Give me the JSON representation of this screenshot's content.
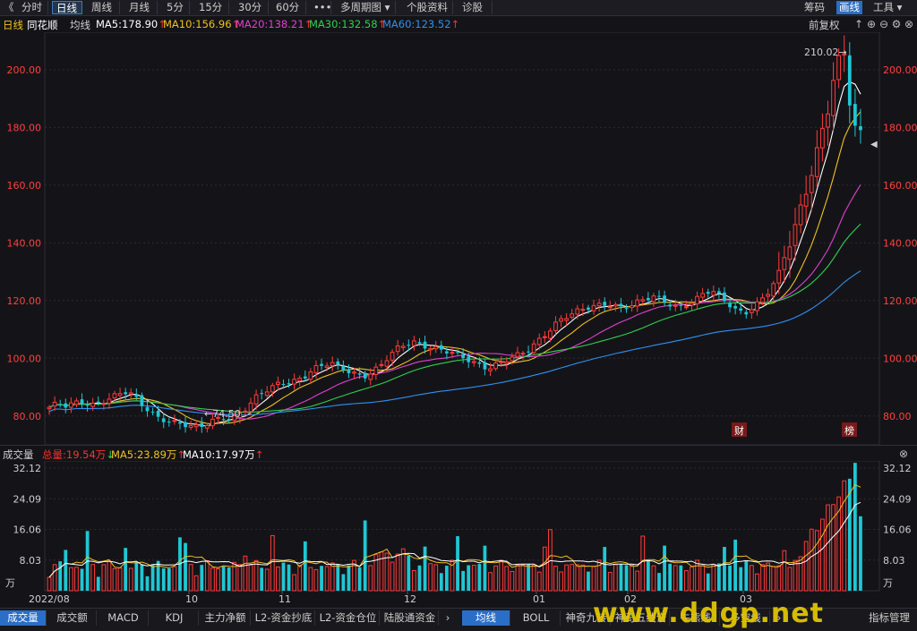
{
  "toolbar": {
    "back_icon": "《",
    "tabs": [
      "分时",
      "日线",
      "周线",
      "月线",
      "5分",
      "15分",
      "30分",
      "60分",
      "•••",
      "多周期图",
      "个股资料",
      "诊股"
    ],
    "active_tab": 1,
    "right_items": [
      "筹码",
      "画线",
      "工具"
    ]
  },
  "infobar": {
    "period": "日线",
    "stock_name": "同花顺",
    "ma_label": "均线",
    "ma_values": [
      {
        "text": "MA5:178.90",
        "color": "#ffffff"
      },
      {
        "text": "MA10:156.96",
        "color": "#f0c020"
      },
      {
        "text": "MA20:138.21",
        "color": "#e040d0"
      },
      {
        "text": "MA30:132.58",
        "color": "#30d050"
      },
      {
        "text": "MA60:123.52",
        "color": "#3090f0"
      }
    ],
    "adjust": "前复权"
  },
  "volbar": {
    "title": "成交量",
    "total": "总量:19.54万",
    "ma5": "MA5:23.89万",
    "ma10": "MA10:17.97万"
  },
  "chart_data": [
    {
      "type": "candlestick",
      "title": "同花顺 日线",
      "y_ticks": [
        "200.00",
        "180.00",
        "160.00",
        "140.00",
        "120.00",
        "100.00",
        "80.00"
      ],
      "ylim": [
        70,
        213
      ],
      "annotations": {
        "high": "210.02→",
        "low": "←74.50",
        "markers": [
          "财",
          "榜"
        ]
      },
      "price_path": [
        83,
        84,
        83,
        84,
        85,
        84,
        85,
        86,
        87,
        88,
        87,
        84,
        82,
        80,
        79,
        78,
        77,
        76,
        75.5,
        77,
        79,
        80,
        79,
        81,
        83,
        86,
        88,
        90,
        92,
        92,
        93,
        94,
        96,
        97,
        98,
        97,
        96,
        95,
        94,
        95,
        97,
        100,
        103,
        105,
        106,
        105,
        104,
        103,
        102,
        101,
        100,
        99,
        98,
        97,
        98,
        99,
        100,
        101,
        103,
        106,
        109,
        112,
        114,
        115,
        116,
        117,
        118,
        119,
        119,
        118,
        118,
        119,
        120,
        121,
        120,
        119,
        118,
        119,
        120,
        122,
        123,
        121,
        119,
        117,
        116,
        118,
        120,
        123,
        128,
        136,
        145,
        155,
        165,
        175,
        185,
        200,
        205,
        181,
        178
      ],
      "ma_series": [
        {
          "name": "MA5",
          "color": "#ffffff"
        },
        {
          "name": "MA10",
          "color": "#f0c020"
        },
        {
          "name": "MA20",
          "color": "#e040d0"
        },
        {
          "name": "MA30",
          "color": "#30d050"
        },
        {
          "name": "MA60",
          "color": "#3090f0"
        }
      ]
    },
    {
      "type": "bar",
      "title": "成交量",
      "y_ticks": [
        "32.12",
        "24.09",
        "16.06",
        "8.03"
      ],
      "unit": "万",
      "ylim": [
        0,
        34
      ],
      "x_labels": [
        "2022/08",
        "10",
        "11",
        "12",
        "01",
        "02",
        "03"
      ]
    }
  ],
  "bottombar": {
    "left_tabs": [
      "成交量",
      "成交额",
      "MACD",
      "KDJ",
      "主力净额",
      "L2-资金抄底",
      "L2-资金仓位",
      "陆股通资金"
    ],
    "right_tabs": [
      "均线",
      "BOLL",
      "神奇九转",
      "神奇五线谱",
      "牛熊线",
      "多空线"
    ],
    "more_icon": "›",
    "manage": "指标管理"
  },
  "watermark": "www.ddgp.net"
}
